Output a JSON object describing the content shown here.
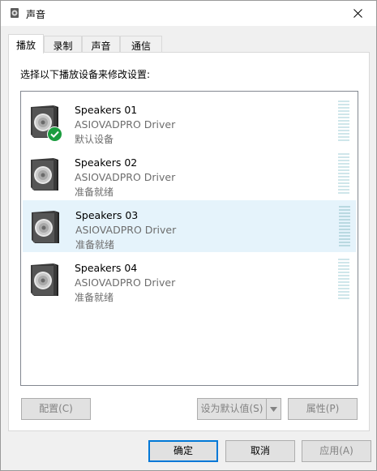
{
  "window": {
    "title": "声音",
    "icon": "speaker-icon"
  },
  "tabs": [
    {
      "label": "播放",
      "active": true
    },
    {
      "label": "录制",
      "active": false
    },
    {
      "label": "声音",
      "active": false
    },
    {
      "label": "通信",
      "active": false
    }
  ],
  "playback": {
    "prompt": "选择以下播放设备来修改设置:",
    "devices": [
      {
        "name": "Speakers 01",
        "driver": "ASIOVADPRO Driver",
        "status": "默认设备",
        "default": true,
        "selected": false
      },
      {
        "name": "Speakers 02",
        "driver": "ASIOVADPRO Driver",
        "status": "准备就绪",
        "default": false,
        "selected": false
      },
      {
        "name": "Speakers 03",
        "driver": "ASIOVADPRO Driver",
        "status": "准备就绪",
        "default": false,
        "selected": true
      },
      {
        "name": "Speakers 04",
        "driver": "ASIOVADPRO Driver",
        "status": "准备就绪",
        "default": false,
        "selected": false
      }
    ],
    "buttons": {
      "configure": "配置(C)",
      "set_default": "设为默认值(S)",
      "properties": "属性(P)"
    }
  },
  "dialog_buttons": {
    "ok": "确定",
    "cancel": "取消",
    "apply": "应用(A)"
  },
  "colors": {
    "selection": "#e5f3fb",
    "accent": "#0078d7",
    "default_check": "#1a9c3e"
  }
}
